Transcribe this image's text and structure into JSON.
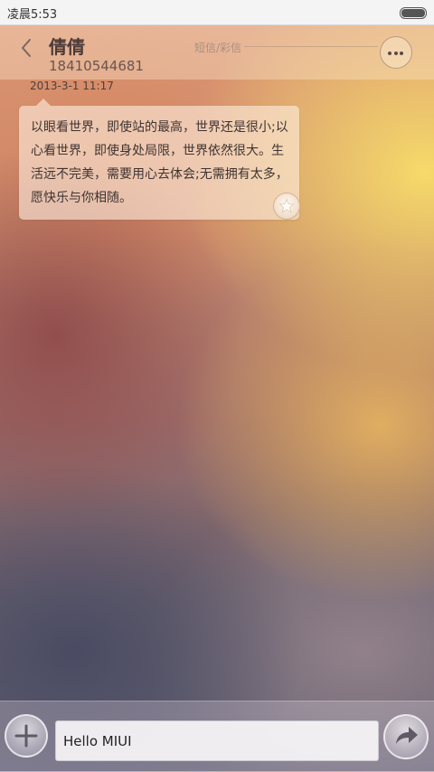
{
  "status_bar": {
    "time": "凌晨5:53",
    "battery_level": 1.0
  },
  "header": {
    "contact_name": "倩倩",
    "contact_number": "18410544681",
    "message_type": "短信/彩信"
  },
  "conversation": {
    "messages": [
      {
        "timestamp": "2013-3-1 11:17",
        "text": "以眼看世界，即使站的最高，世界还是很小;以心看世界，即使身处局限，世界依然很大。生活远不完美，需要用心去体会;无需拥有太多，愿快乐与你相随。",
        "starred": false
      }
    ]
  },
  "composer": {
    "input_value": "Hello MIUI"
  },
  "icons": {
    "back": "chevron-left-icon",
    "more": "more-dots-icon",
    "star": "star-icon",
    "add": "plus-icon",
    "send": "send-arrow-icon"
  }
}
